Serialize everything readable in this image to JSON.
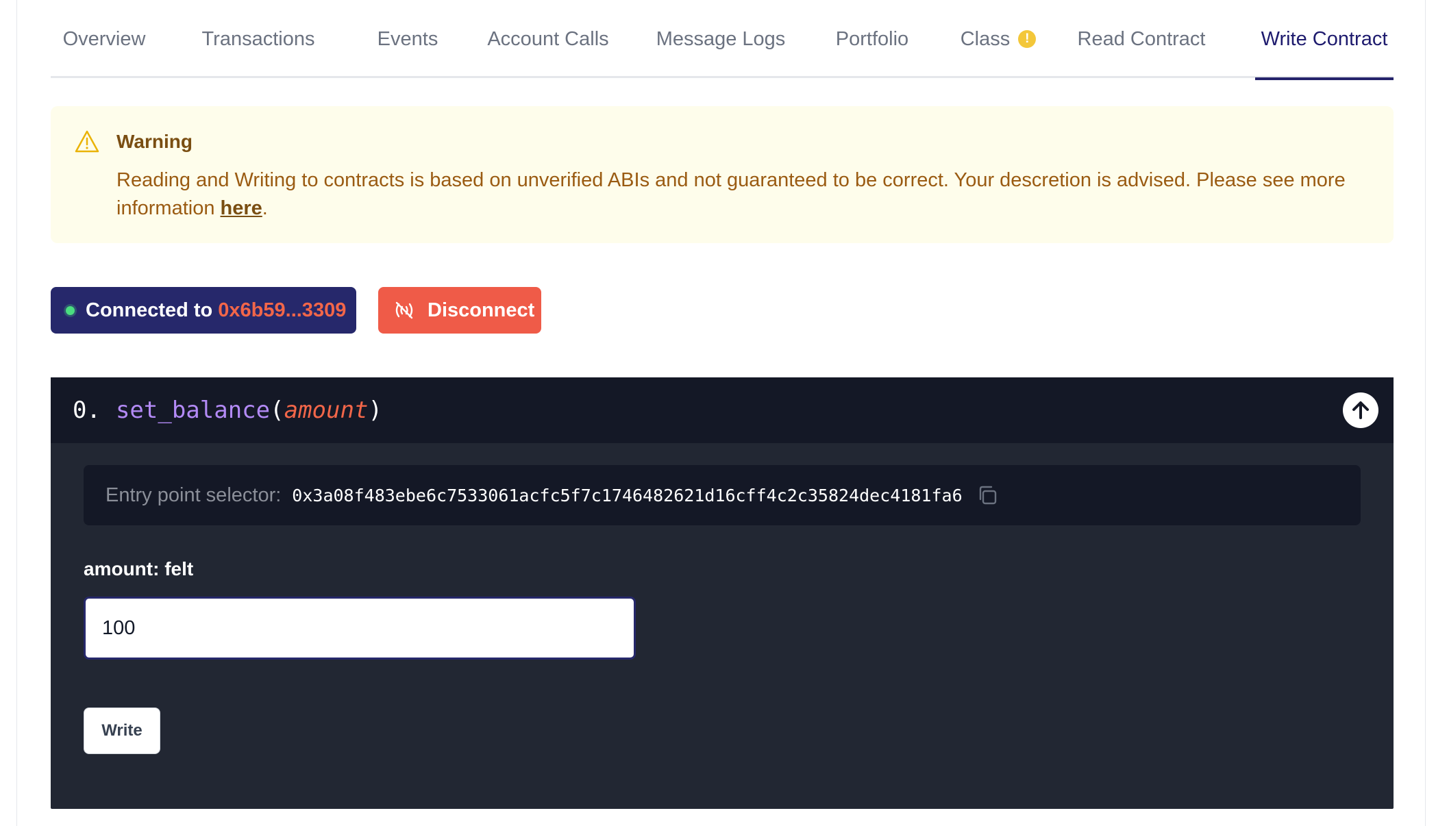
{
  "tabs": [
    {
      "label": "Overview"
    },
    {
      "label": "Transactions"
    },
    {
      "label": "Events"
    },
    {
      "label": "Account Calls"
    },
    {
      "label": "Message Logs"
    },
    {
      "label": "Portfolio"
    },
    {
      "label": "Class",
      "badge": "!"
    },
    {
      "label": "Read Contract"
    },
    {
      "label": "Write Contract",
      "active": true
    }
  ],
  "warning": {
    "title": "Warning",
    "message_prefix": "Reading and Writing to contracts is based on unverified ABIs and not guaranteed to be correct. Your descretion is advised. Please see more information ",
    "link_text": "here",
    "message_suffix": "."
  },
  "connection": {
    "prefix": "Connected to",
    "address": "0x6b59...3309",
    "disconnect_label": "Disconnect"
  },
  "function": {
    "index": "0.",
    "name": "set_balance",
    "open_paren": "(",
    "arg": "amount",
    "close_paren": ")",
    "selector_label": "Entry point selector:",
    "selector_value": "0x3a08f483ebe6c7533061acfc5f7c1746482621d16cff4c2c35824dec4181fa6",
    "param_label": "amount: felt",
    "param_value": "100",
    "write_label": "Write"
  },
  "colors": {
    "accent": "#26286b",
    "danger": "#ef5b48",
    "function_name": "#b38af6",
    "argument": "#f26649"
  }
}
